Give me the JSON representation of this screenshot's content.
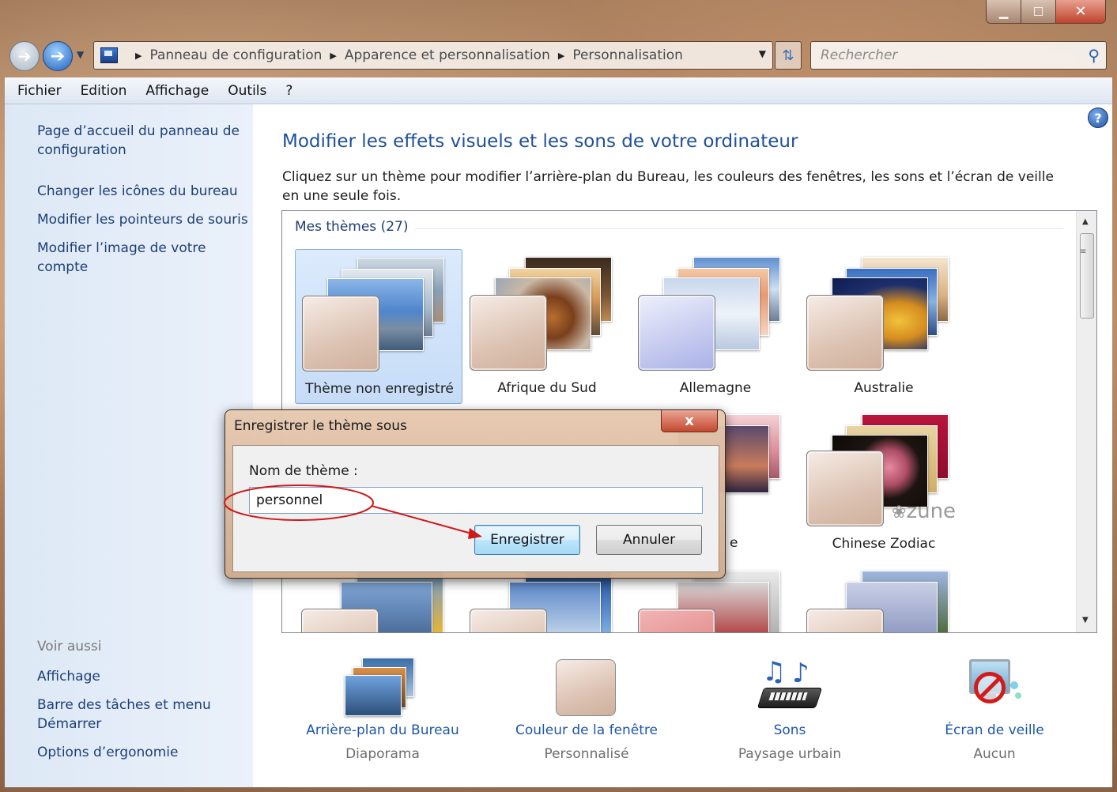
{
  "window": {
    "minimize_glyph": "▁",
    "maximize_glyph": "☐",
    "close_glyph": "✕"
  },
  "nav": {
    "breadcrumbs": [
      "Panneau de configuration",
      "Apparence et personnalisation",
      "Personnalisation"
    ],
    "search_placeholder": "Rechercher"
  },
  "menu": [
    "Fichier",
    "Edition",
    "Affichage",
    "Outils",
    "?"
  ],
  "left_pane": {
    "links": [
      "Page d’accueil du panneau de configuration",
      "Changer les icônes du bureau",
      "Modifier les pointeurs de souris",
      "Modifier l’image de votre compte"
    ],
    "see_also_title": "Voir aussi",
    "see_also": [
      "Affichage",
      "Barre des tâches et menu Démarrer",
      "Options d’ergonomie"
    ]
  },
  "main": {
    "title": "Modifier les effets visuels et les sons de votre ordinateur",
    "description": "Cliquez sur un thème pour modifier l’arrière-plan du Bureau, les couleurs des fenêtres, les sons et l’écran de veille en une seule fois.",
    "section_title": "Mes thèmes (27)",
    "themes": [
      {
        "label": "Thème non enregistré",
        "selected": true
      },
      {
        "label": "Afrique du Sud",
        "selected": false
      },
      {
        "label": "Allemagne",
        "selected": false
      },
      {
        "label": "Australie",
        "selected": false
      },
      {
        "label": "Chinese Zodiac",
        "selected": false,
        "badge": "zune"
      }
    ],
    "partial_label_fragment": "e"
  },
  "settings": [
    {
      "link": "Arrière-plan du Bureau",
      "value": "Diaporama",
      "icon": "desktop-background-icon"
    },
    {
      "link": "Couleur de la fenêtre",
      "value": "Personnalisé",
      "icon": "window-color-icon"
    },
    {
      "link": "Sons",
      "value": "Paysage urbain",
      "icon": "sounds-icon"
    },
    {
      "link": "Écran de veille",
      "value": "Aucun",
      "icon": "screensaver-icon"
    }
  ],
  "dialog": {
    "title": "Enregistrer le thème sous",
    "close_glyph": "x",
    "name_label": "Nom de thème :",
    "name_value": "personnel",
    "save_label": "Enregistrer",
    "cancel_label": "Annuler"
  },
  "colors": {
    "link": "#1e3f74",
    "title": "#1f4f9a",
    "annotation": "#d01818",
    "selection": "#c6dcf7"
  }
}
